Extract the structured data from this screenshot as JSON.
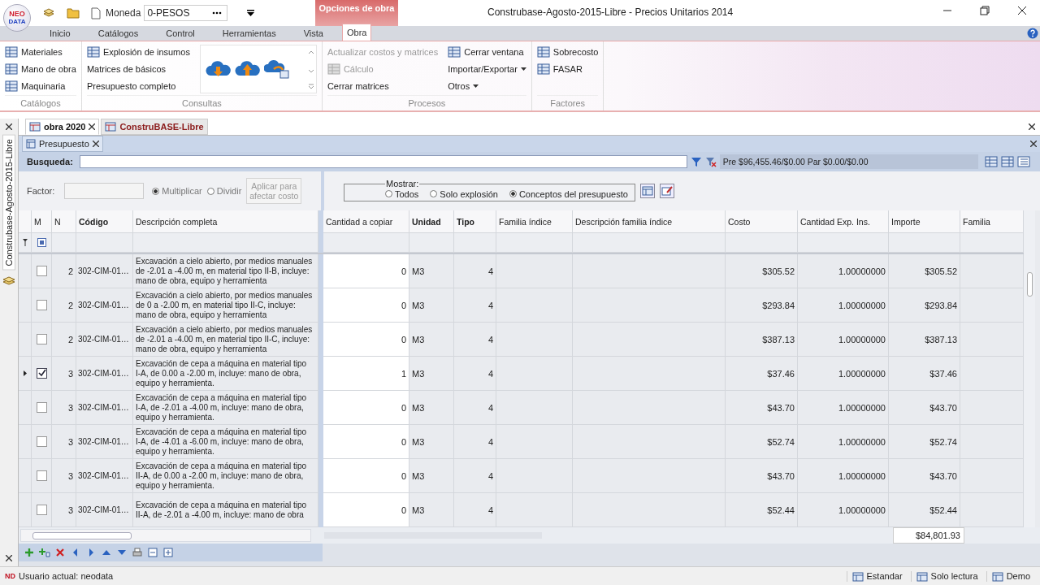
{
  "app": {
    "logo_top": "NEO",
    "logo_bottom": "DATA"
  },
  "quick_access": {
    "currency_label": "Moneda",
    "currency_value": "0-PESOS"
  },
  "context_tab": "Opciones de obra",
  "window": {
    "title": "Construbase-Agosto-2015-Libre - Precios Unitarios 2014"
  },
  "ribbon_tabs": [
    {
      "label": "Inicio",
      "selected": false
    },
    {
      "label": "Catálogos",
      "selected": false
    },
    {
      "label": "Control",
      "selected": false
    },
    {
      "label": "Herramientas",
      "selected": false
    },
    {
      "label": "Vista",
      "selected": false
    },
    {
      "label": "Obra",
      "selected": true
    }
  ],
  "ribbon_groups": [
    {
      "title": "Catálogos",
      "columns": [
        [
          {
            "label": "Materiales",
            "has_icon": true,
            "disabled": false,
            "dropdown": false
          },
          {
            "label": "Mano de obra",
            "has_icon": true,
            "disabled": false,
            "dropdown": false
          },
          {
            "label": "Maquinaria",
            "has_icon": true,
            "disabled": false,
            "dropdown": false
          }
        ]
      ]
    },
    {
      "title": "Consultas",
      "columns": [
        [
          {
            "label": "Explosión de insumos",
            "has_icon": true,
            "disabled": false,
            "dropdown": false
          },
          {
            "label": "Matrices de básicos",
            "has_icon": false,
            "disabled": false,
            "dropdown": false
          },
          {
            "label": "Presupuesto completo",
            "has_icon": false,
            "disabled": false,
            "dropdown": false
          }
        ]
      ],
      "gallery": [
        {
          "kind": "download"
        },
        {
          "kind": "upload"
        },
        {
          "kind": "sync"
        }
      ]
    },
    {
      "title": "Procesos",
      "columns": [
        [
          {
            "label": "Actualizar costos y matrices",
            "has_icon": false,
            "disabled": true,
            "dropdown": false
          },
          {
            "label": "Cálculo",
            "has_icon": true,
            "disabled": true,
            "dropdown": false
          },
          {
            "label": "Cerrar matrices",
            "has_icon": false,
            "disabled": false,
            "dropdown": false
          }
        ],
        [
          {
            "label": "Cerrar ventana",
            "has_icon": true,
            "disabled": false,
            "dropdown": false
          },
          {
            "label": "Importar/Exportar",
            "has_icon": false,
            "disabled": false,
            "dropdown": true
          },
          {
            "label": "Otros",
            "has_icon": false,
            "disabled": false,
            "dropdown": true
          }
        ]
      ]
    },
    {
      "title": "Factores",
      "columns": [
        [
          {
            "label": "Sobrecosto",
            "has_icon": true,
            "disabled": false,
            "dropdown": false
          },
          {
            "label": "FASAR",
            "has_icon": true,
            "disabled": false,
            "dropdown": false
          }
        ]
      ]
    }
  ],
  "side_panel": {
    "title": "Construbase-Agosto-2015-Libre"
  },
  "document_tabs": [
    {
      "label": "obra 2020",
      "selected": true
    },
    {
      "label": "ConstruBASE-Libre",
      "selected": false
    }
  ],
  "sub_tabs": [
    {
      "label": "Presupuesto",
      "selected": true
    }
  ],
  "search": {
    "label": "Busqueda:",
    "summary": "Pre $96,455.46/$0.00 Par $0.00/$0.00"
  },
  "options": {
    "factor_label": "Factor:",
    "factor_modes": [
      {
        "label": "Multiplicar",
        "selected": true
      },
      {
        "label": "Dividir",
        "selected": false
      }
    ],
    "apply_button": "Aplicar para afectar costo",
    "show_label": "Mostrar:",
    "show_modes": [
      {
        "label": "Todos",
        "selected": false
      },
      {
        "label": "Solo explosión",
        "selected": false
      },
      {
        "label": "Conceptos del presupuesto",
        "selected": true
      }
    ]
  },
  "table": {
    "columns": [
      {
        "label": "M",
        "bold": false
      },
      {
        "label": "N",
        "bold": false
      },
      {
        "label": "Código",
        "bold": true
      },
      {
        "label": "Descripción completa",
        "bold": false
      },
      {
        "label": "Cantidad a copiar",
        "bold": false
      },
      {
        "label": "Unidad",
        "bold": true
      },
      {
        "label": "Tipo",
        "bold": true
      },
      {
        "label": "Familia índice",
        "bold": false
      },
      {
        "label": "Descripción familia índice",
        "bold": false
      },
      {
        "label": "Costo",
        "bold": false
      },
      {
        "label": "Cantidad Exp. Ins.",
        "bold": false
      },
      {
        "label": "Importe",
        "bold": false
      },
      {
        "label": "Familia",
        "bold": false
      }
    ],
    "rows": [
      {
        "selected": false,
        "checked": false,
        "n": "2",
        "code": "302-CIM-01…",
        "description": [
          "Excavación a cielo abierto, por medios manuales",
          "de -2.01 a -4.00 m, en material tipo II-B, incluye:",
          "mano de obra, equipo y herramienta"
        ],
        "quantity": "0",
        "unit": "M3",
        "type": "4",
        "cost": "$305.52",
        "exp_qty": "1.00000000",
        "amount": "$305.52"
      },
      {
        "selected": false,
        "checked": false,
        "n": "2",
        "code": "302-CIM-01…",
        "description": [
          "Excavación a cielo abierto, por medios manuales",
          "de 0 a -2.00 m, en material tipo II-C, incluye:",
          "mano de obra, equipo y herramienta"
        ],
        "quantity": "0",
        "unit": "M3",
        "type": "4",
        "cost": "$293.84",
        "exp_qty": "1.00000000",
        "amount": "$293.84"
      },
      {
        "selected": false,
        "checked": false,
        "n": "2",
        "code": "302-CIM-01…",
        "description": [
          "Excavación a cielo abierto, por medios manuales",
          "de -2.01 a -4.00 m, en material tipo II-C, incluye:",
          "mano de obra, equipo y herramienta"
        ],
        "quantity": "0",
        "unit": "M3",
        "type": "4",
        "cost": "$387.13",
        "exp_qty": "1.00000000",
        "amount": "$387.13"
      },
      {
        "selected": true,
        "checked": true,
        "n": "3",
        "code": "302-CIM-01…",
        "description": [
          "Excavación de cepa a máquina en material tipo",
          "I-A, de 0.00 a -2.00 m, incluye: mano de obra,",
          "equipo y herramienta."
        ],
        "quantity": "1",
        "unit": "M3",
        "type": "4",
        "cost": "$37.46",
        "exp_qty": "1.00000000",
        "amount": "$37.46"
      },
      {
        "selected": false,
        "checked": false,
        "n": "3",
        "code": "302-CIM-01…",
        "description": [
          "Excavación de cepa a máquina en material tipo",
          "I-A,  de  -2.01 a -4.00 m, incluye: mano de obra,",
          "equipo y herramienta."
        ],
        "quantity": "0",
        "unit": "M3",
        "type": "4",
        "cost": "$43.70",
        "exp_qty": "1.00000000",
        "amount": "$43.70"
      },
      {
        "selected": false,
        "checked": false,
        "n": "3",
        "code": "302-CIM-01…",
        "description": [
          "Excavación de cepa a máquina en material tipo",
          "I-A,  de  -4.01 a -6.00 m, incluye: mano de obra,",
          "equipo y herramienta."
        ],
        "quantity": "0",
        "unit": "M3",
        "type": "4",
        "cost": "$52.74",
        "exp_qty": "1.00000000",
        "amount": "$52.74"
      },
      {
        "selected": false,
        "checked": false,
        "n": "3",
        "code": "302-CIM-01…",
        "description": [
          "Excavación de cepa a máquina en material tipo",
          "II-A, de 0.00 a -2.00 m, incluye: mano de obra,",
          "equipo y herramienta."
        ],
        "quantity": "0",
        "unit": "M3",
        "type": "4",
        "cost": "$43.70",
        "exp_qty": "1.00000000",
        "amount": "$43.70"
      },
      {
        "selected": false,
        "checked": false,
        "n": "3",
        "code": "302-CIM-01…",
        "description": [
          "Excavación de cepa a máquina en material tipo",
          "II-A,  de  -2.01 a -4.00 m, incluye: mano de obra"
        ],
        "quantity": "0",
        "unit": "M3",
        "type": "4",
        "cost": "$52.44",
        "exp_qty": "1.00000000",
        "amount": "$52.44"
      }
    ],
    "total": "$84,801.93"
  },
  "status_bar": {
    "logo": "ND",
    "user": "Usuario actual: neodata",
    "items": [
      {
        "label": "Estandar"
      },
      {
        "label": "Solo lectura"
      },
      {
        "label": "Demo"
      }
    ]
  }
}
